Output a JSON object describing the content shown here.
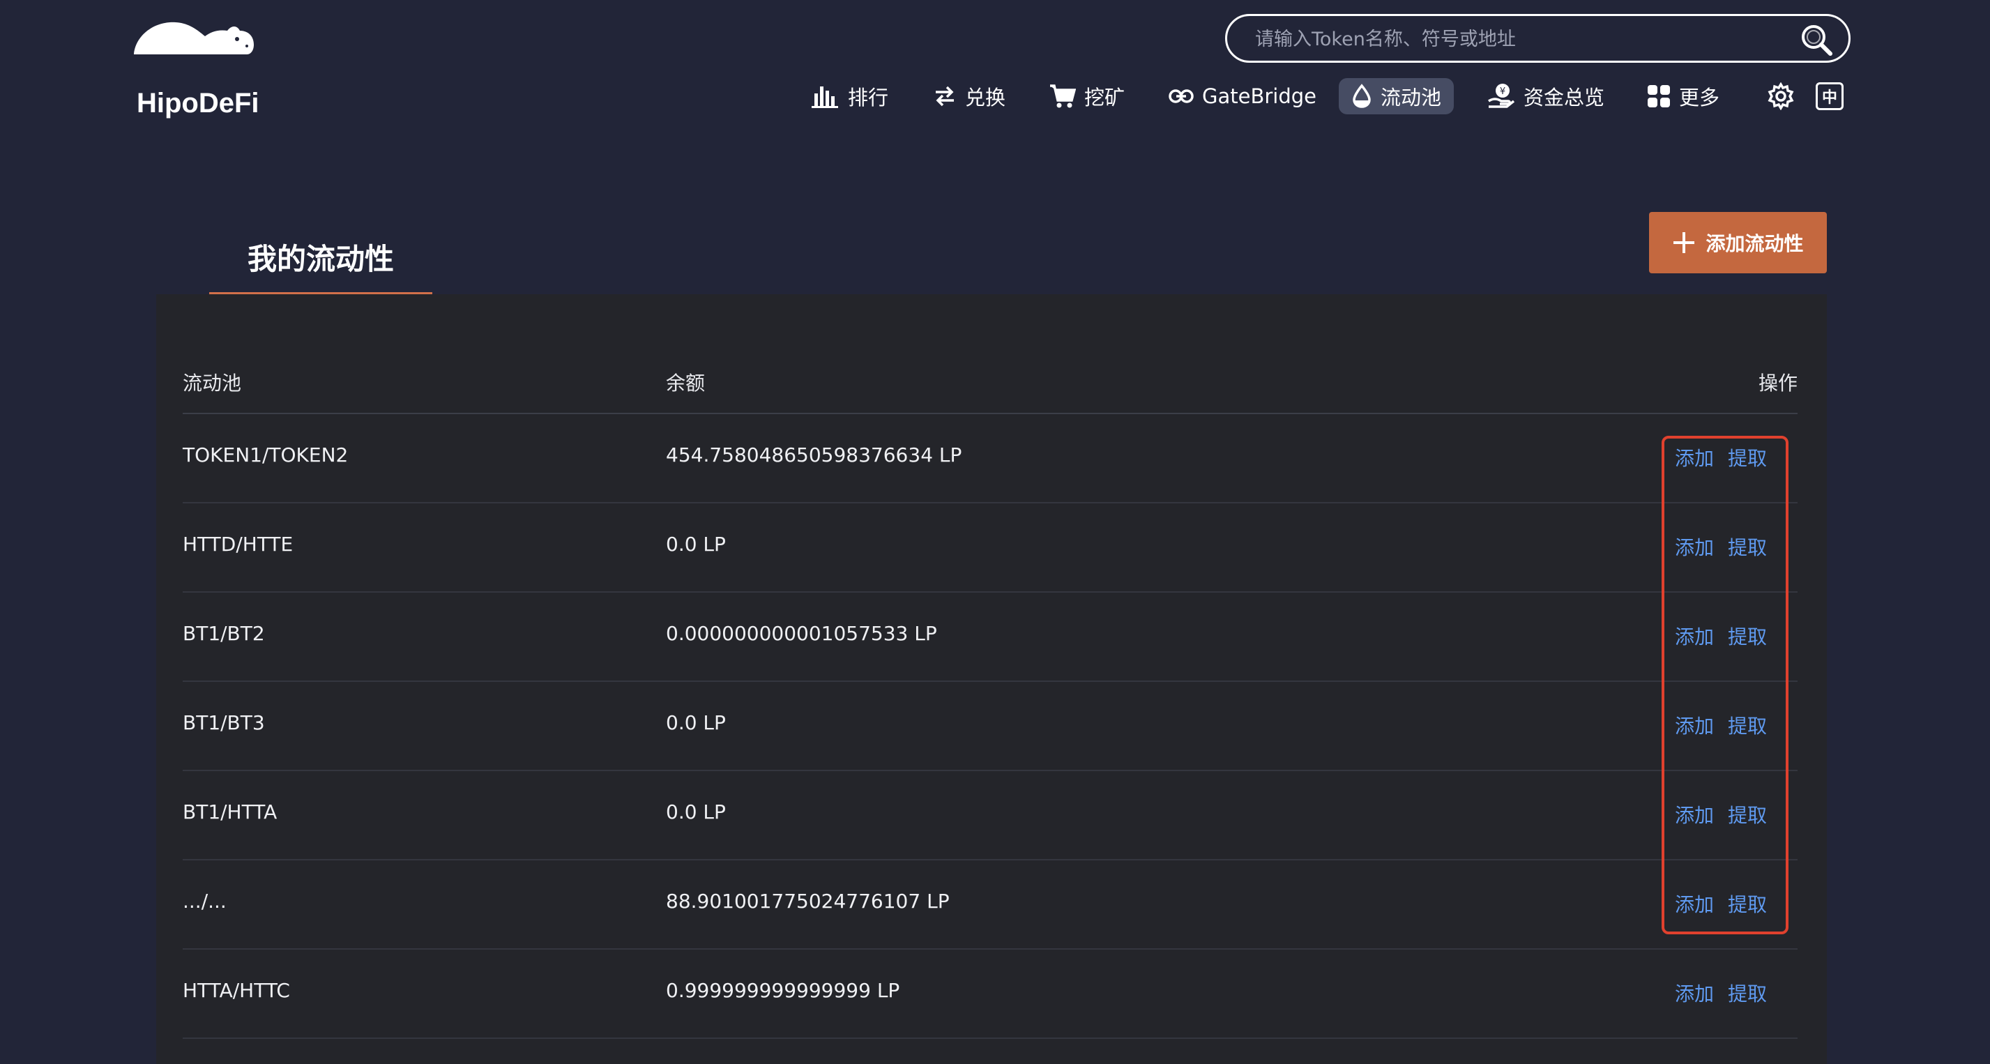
{
  "brand": {
    "name": "HipoDeFi",
    "logo_icon": "hippo-logo-icon"
  },
  "search": {
    "placeholder": "请输入Token名称、符号或地址",
    "value": ""
  },
  "nav": {
    "items": [
      {
        "label": "排行",
        "icon": "bar-chart-icon"
      },
      {
        "label": "兑换",
        "icon": "swap-arrows-icon"
      },
      {
        "label": "挖矿",
        "icon": "cart-icon"
      },
      {
        "label": "GateBridge",
        "icon": "link-icon"
      },
      {
        "label": "流动池",
        "icon": "droplet-icon",
        "active": true
      },
      {
        "label": "资金总览",
        "icon": "funds-hand-icon"
      },
      {
        "label": "更多",
        "icon": "grid-icon"
      }
    ],
    "settings_icon": "gear-icon",
    "language_label": "中"
  },
  "page": {
    "tab_title": "我的流动性",
    "add_button_label": "添加流动性"
  },
  "table": {
    "headers": {
      "pool": "流动池",
      "balance": "余额",
      "actions": "操作"
    },
    "rows": [
      {
        "pool": "TOKEN1/TOKEN2",
        "balance": "454.758048650598376634 LP",
        "add": "添加",
        "withdraw": "提取"
      },
      {
        "pool": "HTTD/HTTE",
        "balance": "0.0 LP",
        "add": "添加",
        "withdraw": "提取"
      },
      {
        "pool": "BT1/BT2",
        "balance": "0.000000000001057533 LP",
        "add": "添加",
        "withdraw": "提取"
      },
      {
        "pool": "BT1/BT3",
        "balance": "0.0 LP",
        "add": "添加",
        "withdraw": "提取"
      },
      {
        "pool": "BT1/HTTA",
        "balance": "0.0 LP",
        "add": "添加",
        "withdraw": "提取"
      },
      {
        "pool": ".../...",
        "balance": "88.901001775024776107 LP",
        "add": "添加",
        "withdraw": "提取"
      },
      {
        "pool": "HTTA/HTTC",
        "balance": "0.999999999999999 LP",
        "add": "添加",
        "withdraw": "提取"
      }
    ]
  },
  "colors": {
    "background": "#222538",
    "panel": "#24252a",
    "accent": "#c4683f",
    "link": "#5f9af0",
    "highlight": "#e0412e"
  }
}
